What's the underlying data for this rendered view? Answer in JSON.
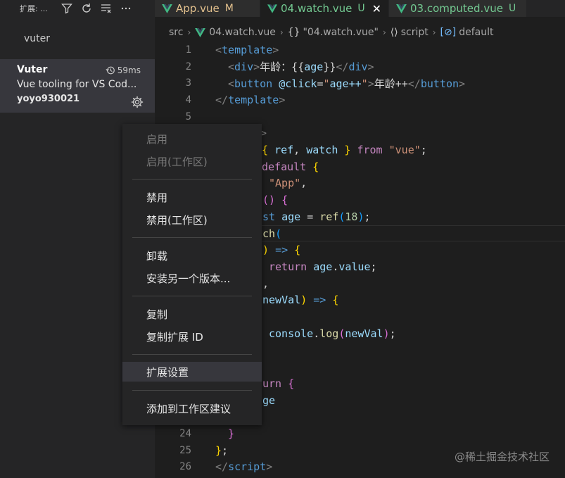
{
  "colors": {
    "modified": "#e2c08d",
    "untracked": "#73c991",
    "vue_green": "#41b883"
  },
  "sidebar": {
    "title": "扩展: ...",
    "header_icons": [
      "filter-icon",
      "refresh-icon",
      "clear-icon",
      "more-icon"
    ],
    "search_value": "vuter",
    "extension": {
      "name": "Vuter",
      "time": "59ms",
      "description": "Vue tooling for VS Cod...",
      "publisher": "yoyo930021"
    }
  },
  "tabs": [
    {
      "label": "App.vue",
      "status": "M",
      "active": false
    },
    {
      "label": "04.watch.vue",
      "status": "U",
      "active": true,
      "close": "✕"
    },
    {
      "label": "03.computed.vue",
      "status": "U",
      "active": false
    }
  ],
  "breadcrumb": {
    "folder": "src",
    "file": "04.watch.vue",
    "sym1": "{}",
    "item1": "\"04.watch.vue\"",
    "sym2": "⟨⟩",
    "item2": "script",
    "sym3": "[⊘]",
    "item3": "default"
  },
  "editor": {
    "line_numbers": [
      "1",
      "2",
      "3",
      "4",
      "5",
      "",
      "",
      "",
      "",
      "",
      "",
      "",
      "",
      "",
      "",
      "",
      "",
      "",
      "",
      "",
      "",
      "",
      "",
      "24",
      "25",
      "26"
    ],
    "lines": {
      "l1_a": "<",
      "l1_b": "template",
      "l1_c": ">",
      "l2_a": "<",
      "l2_b": "div",
      "l2_c": ">",
      "l2_d": "年龄：",
      "l2_e": "{{",
      "l2_f": "age",
      "l2_g": "}}",
      "l2_h": "</",
      "l2_i": "div",
      "l2_j": ">",
      "l3_a": "<",
      "l3_b": "button",
      "l3_c": "@click",
      "l3_d": "=",
      "l3_e": "\"",
      "l3_f": "age++",
      "l3_g": "\"",
      "l3_h": ">",
      "l3_i": "年龄++",
      "l3_j": "</",
      "l3_k": "button",
      "l3_l": ">",
      "l4_a": "</",
      "l4_b": "template",
      "l4_c": ">",
      "l6": ">",
      "l7_a": "{",
      "l7_b": "ref",
      "l7_c": ",",
      "l7_d": "watch",
      "l7_e": "}",
      "l7_f": "from",
      "l7_g": "\"vue\"",
      "l7_h": ";",
      "l8_a": "default",
      "l8_b": "{",
      "l9_a": "\"App\"",
      "l9_b": ",",
      "l10_a": "()",
      "l10_b": "{",
      "l11_a": "st",
      "l11_b": "age",
      "l11_c": "=",
      "l11_d": "ref",
      "l11_e": "(",
      "l11_f": "18",
      "l11_g": ")",
      "l11_h": ";",
      "l12_a": "ch",
      "l12_b": "(",
      "l13_a": ")",
      "l13_b": "=>",
      "l13_c": "{",
      "l14_a": "return",
      "l14_b": "age",
      "l14_c": ".",
      "l14_d": "value",
      "l14_e": ";",
      "l15": ",",
      "l16_a": "newVal",
      "l16_b": ")",
      "l16_c": "=>",
      "l16_d": "{",
      "l18_a": "console",
      "l18_b": ".",
      "l18_c": "log",
      "l18_d": "(",
      "l18_e": "newVal",
      "l18_f": ")",
      "l18_g": ";",
      "l21_a": "urn",
      "l21_b": "{",
      "l22": "ge",
      "l24": "}",
      "l25_a": "}",
      "l25_b": ";",
      "l26_a": "</",
      "l26_b": "script",
      "l26_c": ">"
    }
  },
  "context_menu": {
    "enable": "启用",
    "enable_workspace": "启用(工作区)",
    "disable": "禁用",
    "disable_workspace": "禁用(工作区)",
    "uninstall": "卸载",
    "install_other": "安装另一个版本...",
    "copy": "复制",
    "copy_id": "复制扩展 ID",
    "settings": "扩展设置",
    "add_recommend": "添加到工作区建议"
  },
  "watermark": "@稀土掘金技术社区"
}
